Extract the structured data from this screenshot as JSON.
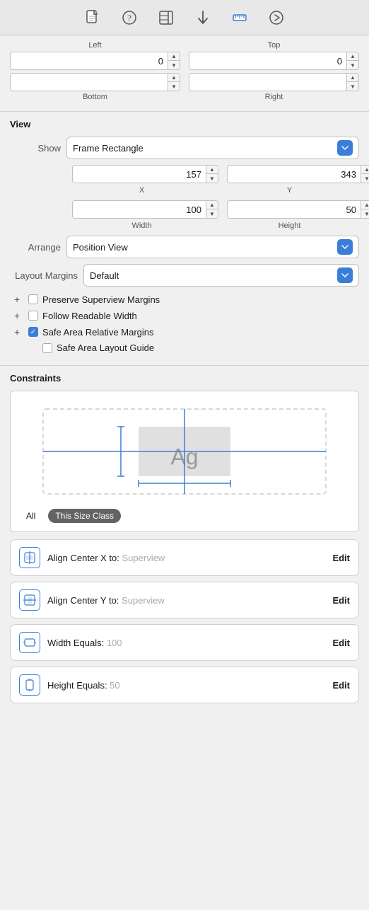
{
  "toolbar": {
    "icons": [
      {
        "name": "file-icon",
        "symbol": "📄",
        "active": false
      },
      {
        "name": "help-icon",
        "symbol": "?",
        "active": false
      },
      {
        "name": "inspector-icon",
        "symbol": "▦",
        "active": false
      },
      {
        "name": "arrow-icon",
        "symbol": "⬇",
        "active": false
      },
      {
        "name": "ruler-icon",
        "symbol": "📏",
        "active": true
      },
      {
        "name": "forward-icon",
        "symbol": "⊕",
        "active": false
      }
    ]
  },
  "top_fields": {
    "left_label": "Left",
    "top_label": "Top",
    "bottom_label": "Bottom",
    "right_label": "Right",
    "left_value": "0",
    "top_value": "0",
    "bottom_value": "",
    "right_value": ""
  },
  "view": {
    "section_title": "View",
    "show_label": "Show",
    "show_value": "Frame Rectangle",
    "x_value": "157",
    "y_value": "343",
    "x_label": "X",
    "y_label": "Y",
    "width_value": "100",
    "height_value": "50",
    "width_label": "Width",
    "height_label": "Height"
  },
  "arrange": {
    "label": "Arrange",
    "value": "Position View"
  },
  "layout_margins": {
    "label": "Layout Margins",
    "value": "Default",
    "preserve_superview": "Preserve Superview Margins",
    "follow_readable": "Follow Readable Width",
    "safe_area_relative": "Safe Area Relative Margins",
    "safe_area_layout": "Safe Area Layout Guide"
  },
  "constraints": {
    "section_title": "Constraints",
    "tab_all": "All",
    "tab_size_class": "This Size Class",
    "items": [
      {
        "id": "align-center-x",
        "icon_type": "align-x",
        "label": "Align Center X to: ",
        "value": "Superview",
        "edit": "Edit"
      },
      {
        "id": "align-center-y",
        "icon_type": "align-y",
        "label": "Align Center Y to: ",
        "value": "Superview",
        "edit": "Edit"
      },
      {
        "id": "width-equals",
        "icon_type": "width",
        "label": "Width Equals: ",
        "value": "100",
        "edit": "Edit"
      },
      {
        "id": "height-equals",
        "icon_type": "height",
        "label": "Height Equals: ",
        "value": "50",
        "edit": "Edit"
      }
    ]
  }
}
